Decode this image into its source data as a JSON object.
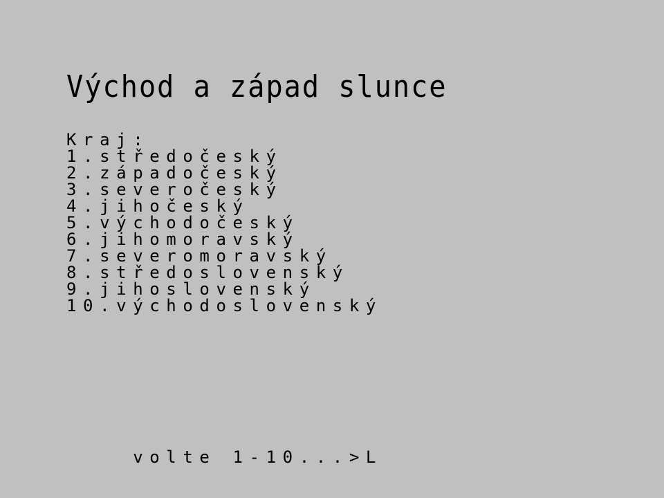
{
  "screen": {
    "title": "Východ a západ slunce",
    "heading": "Kraj:",
    "regions": [
      "1.středočeský",
      "2.západočeský",
      "3.severočeský",
      "4.jihočeský",
      "5.východočeský",
      "6.jihomoravský",
      "7.severomoravský",
      "8.středoslovenský",
      "9.jihoslovenský",
      "10.východoslovenský"
    ],
    "prompt": "volte 1-10...>",
    "cursor": "L"
  },
  "colors": {
    "background": "#c0c0c0",
    "text": "#000000"
  }
}
